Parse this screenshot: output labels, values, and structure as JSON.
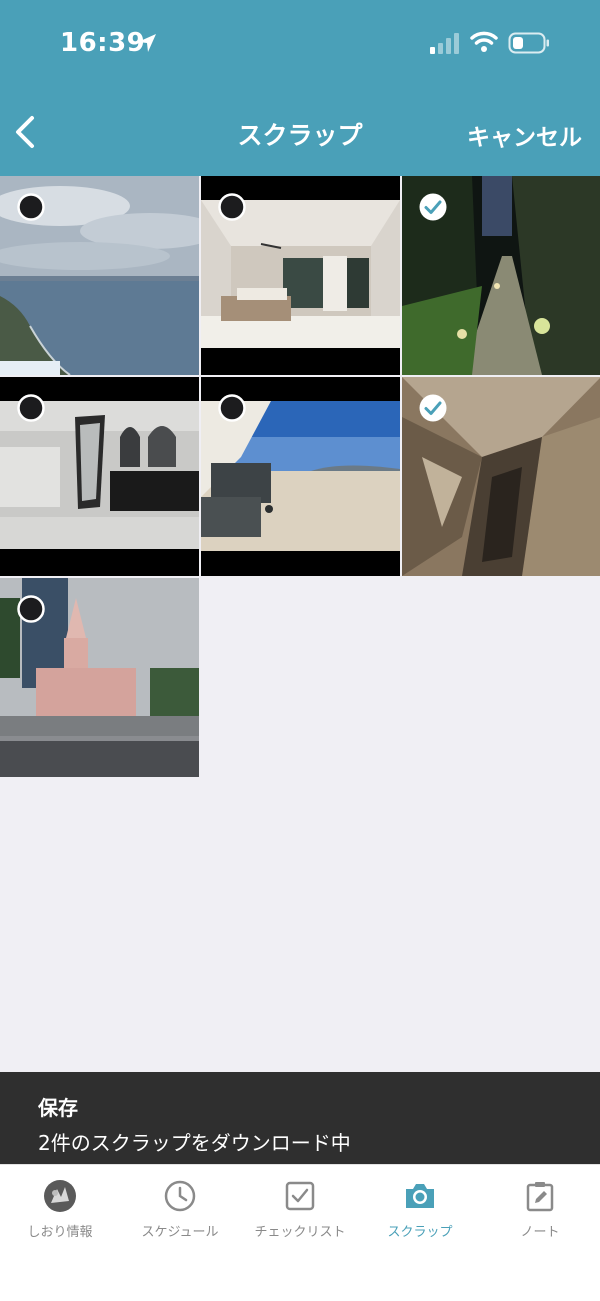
{
  "status_bar": {
    "time": "16:39"
  },
  "nav": {
    "title": "スクラップ",
    "cancel_label": "キャンセル"
  },
  "photos": [
    {
      "subject": "aerial sea view",
      "selected": false
    },
    {
      "subject": "living room",
      "selected": false
    },
    {
      "subject": "garden path at night",
      "selected": true
    },
    {
      "subject": "bathroom",
      "selected": false
    },
    {
      "subject": "beach",
      "selected": false
    },
    {
      "subject": "cave",
      "selected": true
    },
    {
      "subject": "pink cathedral",
      "selected": false
    }
  ],
  "toast": {
    "title": "保存",
    "message": "2件のスクラップをダウンロード中"
  },
  "tabs": [
    {
      "label": "しおり情報",
      "icon": "avatar-icon",
      "active": false
    },
    {
      "label": "スケジュール",
      "icon": "clock-icon",
      "active": false
    },
    {
      "label": "チェックリスト",
      "icon": "checkbox-icon",
      "active": false
    },
    {
      "label": "スクラップ",
      "icon": "camera-icon",
      "active": true
    },
    {
      "label": "ノート",
      "icon": "note-icon",
      "active": false
    }
  ],
  "colors": {
    "accent": "#4aa0b8",
    "toast_bg": "#2f2f2f",
    "background": "#f0eff4"
  }
}
